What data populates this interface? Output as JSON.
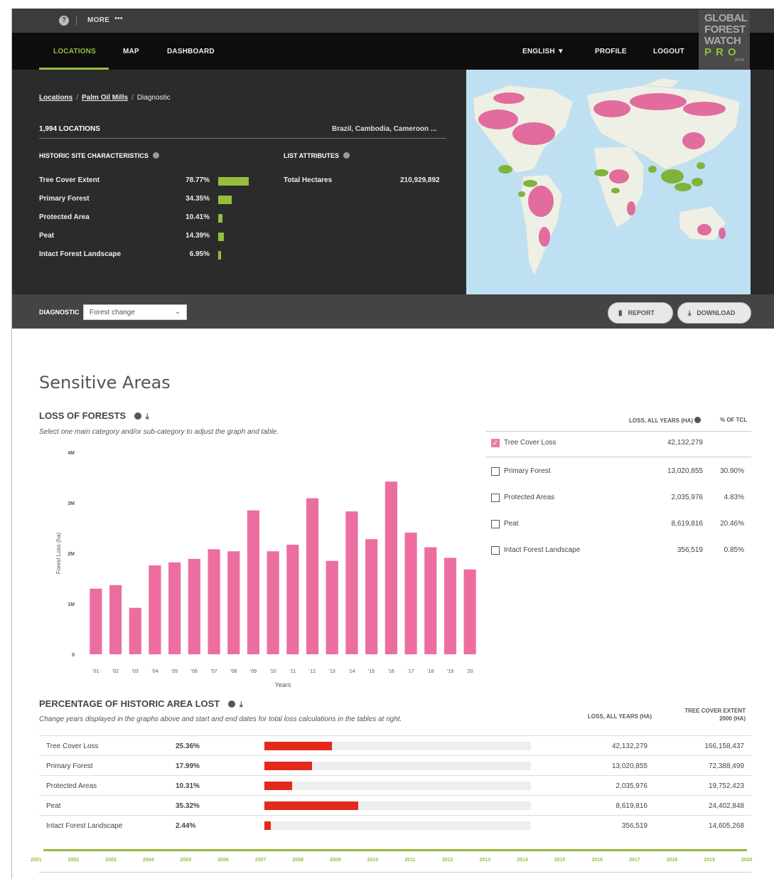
{
  "utility": {
    "more_label": "MORE",
    "more_dots": "•••",
    "help_glyph": "?"
  },
  "nav": {
    "items": [
      "LOCATIONS",
      "MAP",
      "DASHBOARD"
    ],
    "language": "ENGLISH ▼",
    "profile": "PROFILE",
    "logout": "LOGOUT"
  },
  "logo": {
    "line1": "GLOBAL",
    "line2": "FOREST",
    "line3": "WATCH",
    "line4": "PRO",
    "line5": "BETA"
  },
  "breadcrumb": {
    "item1": "Locations",
    "item2": "Palm Oil Mills",
    "item3": "Diagnostic"
  },
  "locations": {
    "count": "1,994 LOCATIONS",
    "countries": "Brazil, Cambodia, Cameroon ..."
  },
  "historic": {
    "heading": "HISTORIC SITE CHARACTERISTICS",
    "rows": [
      {
        "label": "Tree Cover Extent",
        "value": "78.77%",
        "pct": 78.77
      },
      {
        "label": "Primary Forest",
        "value": "34.35%",
        "pct": 34.35
      },
      {
        "label": "Protected Area",
        "value": "10.41%",
        "pct": 10.41
      },
      {
        "label": "Peat",
        "value": "14.39%",
        "pct": 14.39
      },
      {
        "label": "Intact Forest Landscape",
        "value": "6.95%",
        "pct": 6.95
      }
    ]
  },
  "attributes": {
    "heading": "LIST ATTRIBUTES",
    "label": "Total Hectares",
    "value": "210,929,892"
  },
  "diagnostic": {
    "label": "DIAGNOSTIC",
    "selected": "Forest change",
    "report": "REPORT",
    "download": "DOWNLOAD"
  },
  "section": {
    "title": "Sensitive Areas",
    "loss_title": "LOSS OF FORESTS",
    "loss_caption": "Select one main category and/or sub-category to adjust the graph and table.",
    "pct_title": "PERCENTAGE OF HISTORIC AREA LOST",
    "pct_caption": "Change years displayed in the graphs above and start and end dates for total loss calculations in the tables at right."
  },
  "chart_data": {
    "type": "bar",
    "categories": [
      "'01",
      "'02",
      "'03",
      "'04",
      "'05",
      "'06",
      "'07",
      "'08",
      "'09",
      "'10",
      "'11",
      "'12",
      "'13",
      "'14",
      "'15",
      "'16",
      "'17",
      "'18",
      "'19",
      "'20"
    ],
    "values": [
      1.3,
      1.37,
      0.92,
      1.76,
      1.82,
      1.89,
      2.08,
      2.04,
      2.85,
      2.04,
      2.17,
      3.09,
      1.85,
      2.83,
      2.28,
      3.42,
      2.41,
      2.12,
      1.91,
      1.68
    ],
    "xlabel": "Years",
    "ylabel": "Forest Loss (ha)",
    "ylim": [
      0,
      4
    ],
    "yticks": [
      {
        "value": 0,
        "label": "0"
      },
      {
        "value": 1,
        "label": "1M"
      },
      {
        "value": 2,
        "label": "2M"
      },
      {
        "value": 3,
        "label": "3M"
      },
      {
        "value": 4,
        "label": "4M"
      }
    ],
    "bar_color": "#ec6ea0",
    "grid": false
  },
  "categories": {
    "head_loss": "LOSS, ALL YEARS (HA)",
    "head_pct": "% OF TCL",
    "rows": [
      {
        "name": "Tree Cover Loss",
        "loss": "42,132,279",
        "pct": "",
        "checked": "✓"
      },
      {
        "name": "Primary Forest",
        "loss": "13,020,855",
        "pct": "30.90%",
        "checked": ""
      },
      {
        "name": "Protected Areas",
        "loss": "2,035,976",
        "pct": "4.83%",
        "checked": ""
      },
      {
        "name": "Peat",
        "loss": "8,619,816",
        "pct": "20.46%",
        "checked": ""
      },
      {
        "name": "Intact Forest Landscape",
        "loss": "356,519",
        "pct": "0.85%",
        "checked": ""
      }
    ]
  },
  "pct_table": {
    "head_loss": "LOSS, ALL YEARS (HA)",
    "head_extent_1": "TREE COVER EXTENT",
    "head_extent_2": "2000 (HA)",
    "rows": [
      {
        "name": "Tree Cover Loss",
        "value": "25.36%",
        "pct": 25.36,
        "loss": "42,132,279",
        "extent": "166,158,437"
      },
      {
        "name": "Primary Forest",
        "value": "17.99%",
        "pct": 17.99,
        "loss": "13,020,855",
        "extent": "72,388,499"
      },
      {
        "name": "Protected Areas",
        "value": "10.31%",
        "pct": 10.31,
        "loss": "2,035,976",
        "extent": "19,752,423"
      },
      {
        "name": "Peat",
        "value": "35.32%",
        "pct": 35.32,
        "loss": "8,619,816",
        "extent": "24,402,848"
      },
      {
        "name": "Intact Forest Landscape",
        "value": "2.44%",
        "pct": 2.44,
        "loss": "356,519",
        "extent": "14,605,268"
      }
    ]
  },
  "timeline": {
    "years": [
      "2001",
      "2002",
      "2003",
      "2004",
      "2005",
      "2006",
      "2007",
      "2008",
      "2009",
      "2010",
      "2011",
      "2012",
      "2013",
      "2014",
      "2015",
      "2016",
      "2017",
      "2018",
      "2019",
      "2020"
    ]
  },
  "colors": {
    "accent_green": "#97bd3d",
    "loss_pink": "#ec6ea0",
    "loss_red": "#e2291b"
  }
}
